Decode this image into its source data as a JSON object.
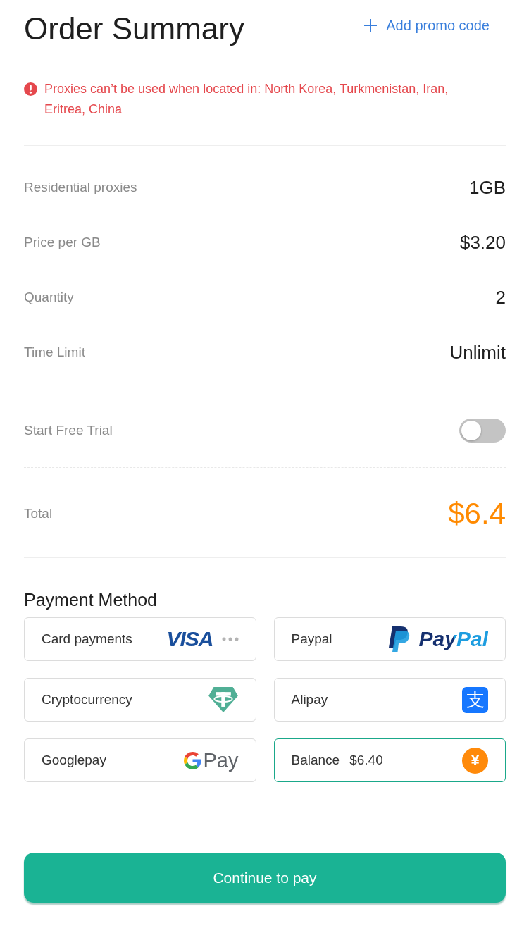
{
  "header": {
    "title": "Order Summary",
    "promo_link": "Add promo code"
  },
  "notice": {
    "text": "Proxies can’t be used when located in: North Korea, Turkmenistan, Iran, Eritrea, China"
  },
  "details": [
    {
      "label": "Residential proxies",
      "value": "1GB"
    },
    {
      "label": "Price per GB",
      "value": "$3.20"
    },
    {
      "label": "Quantity",
      "value": "2"
    },
    {
      "label": "Time Limit",
      "value": "Unlimit"
    }
  ],
  "free_trial": {
    "label": "Start Free Trial",
    "on": false
  },
  "total": {
    "label": "Total",
    "value": "$6.4"
  },
  "payment": {
    "title": "Payment Method",
    "methods": [
      {
        "kind": "card",
        "label": "Card payments",
        "logo_text": "VISA",
        "selected": false
      },
      {
        "kind": "paypal",
        "label": "Paypal",
        "logo_text": "PayPal",
        "selected": false
      },
      {
        "kind": "crypto",
        "label": "Cryptocurrency",
        "selected": false
      },
      {
        "kind": "alipay",
        "label": "Alipay",
        "icon_glyph": "支",
        "selected": false
      },
      {
        "kind": "googlepay",
        "label": "Googlepay",
        "logo_text": "Pay",
        "selected": false
      },
      {
        "kind": "balance",
        "label": "Balance",
        "amount": "$6.40",
        "icon_glyph": "¥",
        "selected": true
      }
    ]
  },
  "continue_button": "Continue to pay"
}
